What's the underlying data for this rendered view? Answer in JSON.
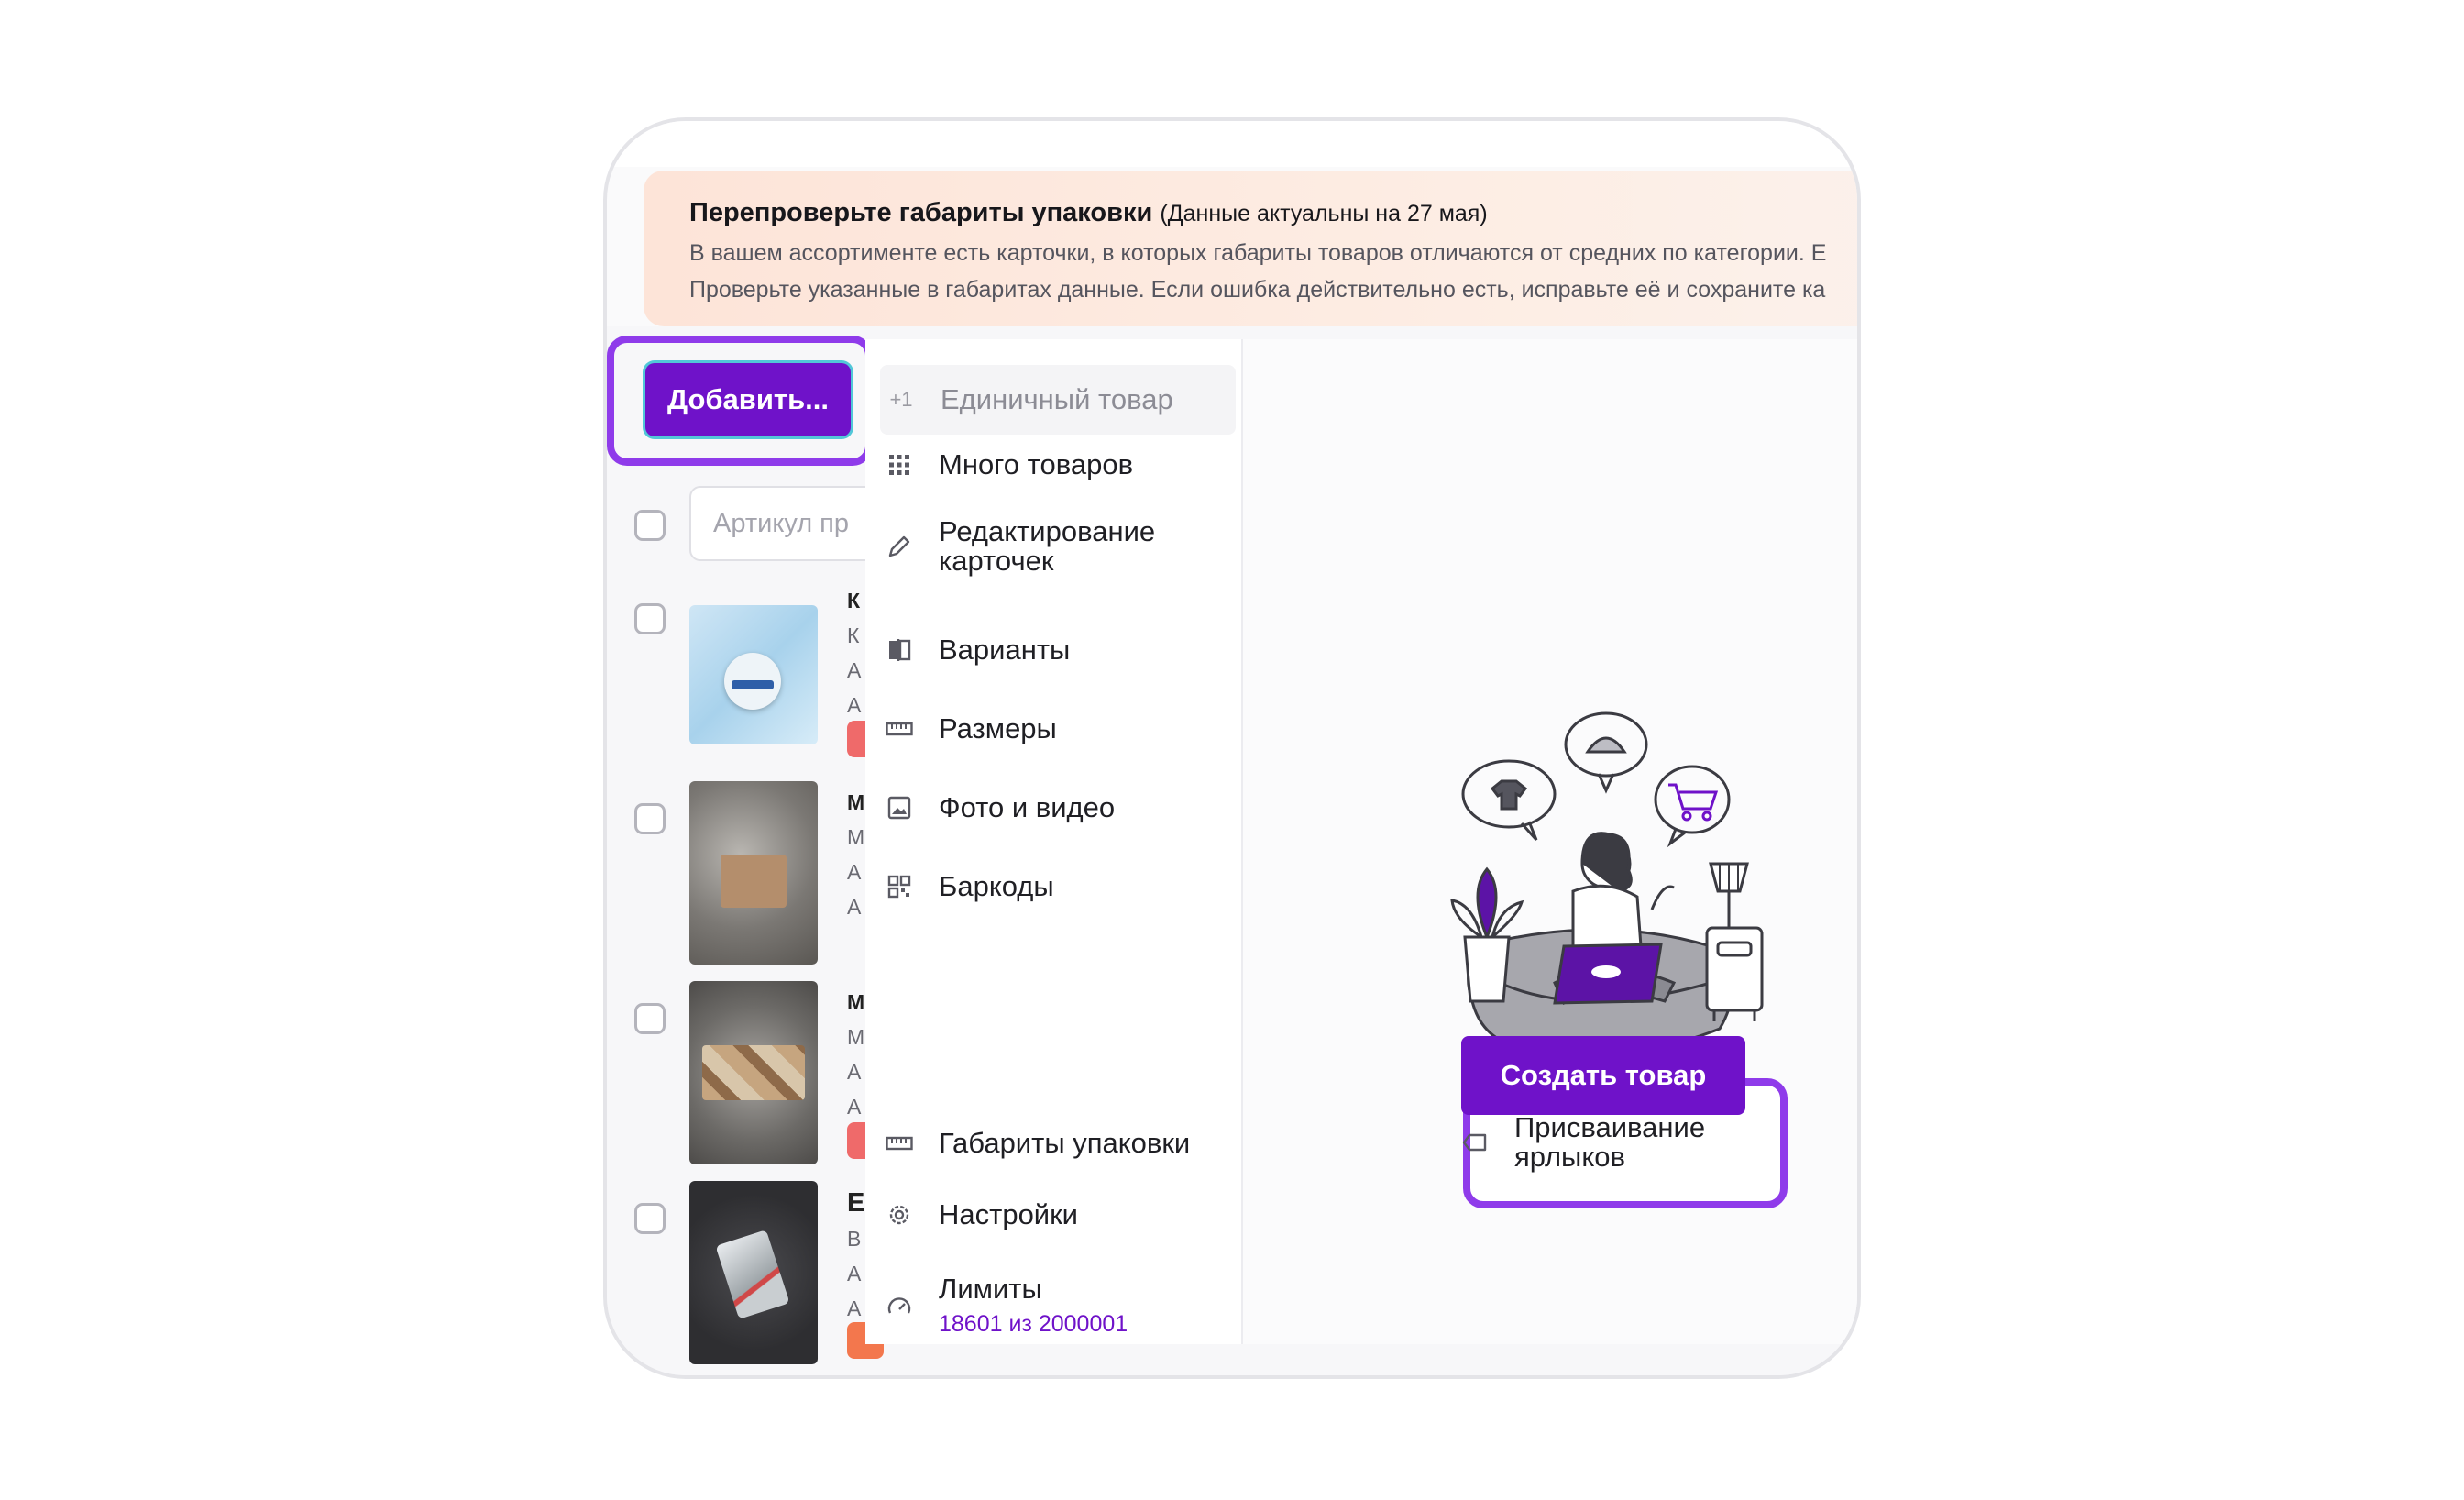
{
  "banner": {
    "title": "Перепроверьте габариты упаковки",
    "note": "(Данные актуальны на 27 мая)",
    "line1": "В вашем ассортименте есть карточки, в которых габариты товаров отличаются от средних по категории. Е",
    "line2": "Проверьте указанные в габаритах данные. Если ошибка действительно есть, исправьте её и сохраните ка"
  },
  "toolbar": {
    "add_label": "Добавить..."
  },
  "search": {
    "placeholder": "Артикул пр"
  },
  "rows": [
    {
      "lines": [
        "К",
        "К",
        "А",
        "А"
      ]
    },
    {
      "lines": [
        "М",
        "М",
        "А",
        "А"
      ]
    },
    {
      "lines": [
        "М",
        "М",
        "А",
        "А"
      ]
    },
    {
      "lines": [
        "Е",
        "В",
        "А",
        "А"
      ]
    }
  ],
  "menu": {
    "items": [
      {
        "label": "Единичный товар",
        "icon": "+1",
        "disabled": true
      },
      {
        "label": "Много товаров",
        "icon": "grid-icon"
      },
      {
        "label": "Редактирование карточек",
        "icon": "pencil-icon"
      },
      {
        "label": "Варианты",
        "icon": "variants-icon"
      },
      {
        "label": "Размеры",
        "icon": "ruler-icon"
      },
      {
        "label": "Фото и видео",
        "icon": "image-icon"
      },
      {
        "label": "Баркоды",
        "icon": "qr-code-icon"
      },
      {
        "label": "Присваивание ярлыков",
        "icon": "tag-icon"
      },
      {
        "label": "Габариты упаковки",
        "icon": "ruler-icon"
      },
      {
        "label": "Настройки",
        "icon": "gear-icon"
      },
      {
        "label": "Лимиты",
        "icon": "gauge-icon",
        "sub": "18601 из 2000001"
      }
    ]
  },
  "main": {
    "create_label": "Создать товар"
  },
  "colors": {
    "accent": "#6f12c9",
    "highlight": "#8f3bea",
    "banner": "#fde4d8"
  }
}
